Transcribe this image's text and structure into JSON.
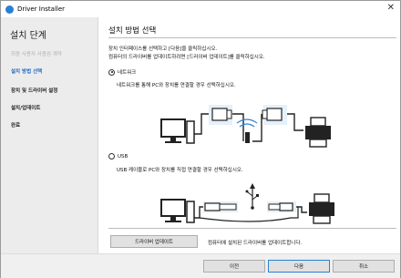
{
  "window": {
    "title": "Driver Installer",
    "close_label": "✕"
  },
  "sidebar": {
    "title": "설치 단계",
    "items": [
      {
        "label": "최종 사용자 사용권 계약",
        "state": "done"
      },
      {
        "label": "설치 방법 선택",
        "state": "current"
      },
      {
        "label": "장치 및 드라이버 설정",
        "state": "pending"
      },
      {
        "label": "설치/업데이트",
        "state": "pending"
      },
      {
        "label": "완료",
        "state": "pending"
      }
    ]
  },
  "main": {
    "title": "설치 방법 선택",
    "description_line1": "장치 인터페이스를 선택하고 [다음]을 클릭하십시오.",
    "description_line2": "컴퓨터의 드라이버를 업데이트하려면 [드라이버 업데이트]를 클릭하십시오.",
    "options": [
      {
        "label": "네트워크",
        "checked": true,
        "description": "네트워크를 통해 PC와 장치를 연결할 경우 선택하십시오."
      },
      {
        "label": "USB",
        "checked": false,
        "description": "USB 케이블로 PC와 장치를 직접 연결할 경우 선택하십시오."
      }
    ],
    "update_button": "드라이버 업데이트",
    "update_note": "컴퓨터에 설치된 드라이버를 업데이트합니다."
  },
  "footer": {
    "back": "이전",
    "next": "다음",
    "cancel": "취소"
  },
  "colors": {
    "accent": "#2a7fd4",
    "sidebar_bg": "#ececec",
    "current_step": "#2a6bbf"
  }
}
